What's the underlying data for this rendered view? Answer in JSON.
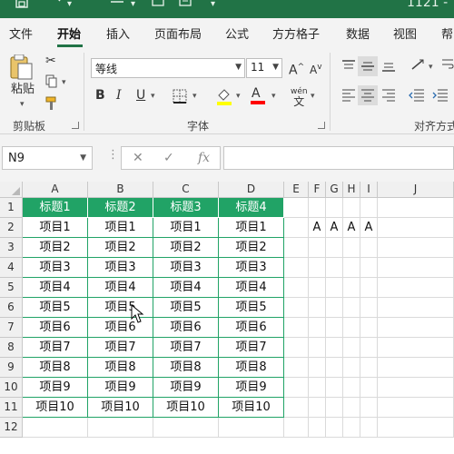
{
  "title_bar": {
    "title_fragment": "1121 -",
    "quick_access": [
      "save-icon",
      "undo-icon",
      "redo-icon"
    ]
  },
  "tabs": [
    "文件",
    "开始",
    "插入",
    "页面布局",
    "公式",
    "方方格子",
    "数据",
    "视图",
    "帮"
  ],
  "active_tab": "开始",
  "ribbon": {
    "clipboard": {
      "paste_label": "粘贴",
      "group_label": "剪贴板"
    },
    "font": {
      "font_name": "等线",
      "font_size": "11",
      "bold": "B",
      "italic": "I",
      "underline": "U",
      "grow_font": "A",
      "shrink_font": "A",
      "font_color_letter": "A",
      "phonetic_top": "wén",
      "phonetic_bottom": "文",
      "group_label": "字体"
    },
    "alignment": {
      "group_label": "对齐方式"
    }
  },
  "formula_bar": {
    "name_box": "N9",
    "formula": "",
    "fx": "fx"
  },
  "sheet": {
    "columns": [
      "A",
      "B",
      "C",
      "D",
      "E",
      "F",
      "G",
      "H",
      "I",
      "J"
    ],
    "rows": [
      "1",
      "2",
      "3",
      "4",
      "5",
      "6",
      "7",
      "8",
      "9",
      "10",
      "11",
      "12"
    ],
    "table_headers": [
      "标题1",
      "标题2",
      "标题3",
      "标题4"
    ],
    "table_rows": [
      [
        "项目1",
        "项目1",
        "项目1",
        "项目1"
      ],
      [
        "项目2",
        "项目2",
        "项目2",
        "项目2"
      ],
      [
        "项目3",
        "项目3",
        "项目3",
        "项目3"
      ],
      [
        "项目4",
        "项目4",
        "项目4",
        "项目4"
      ],
      [
        "项目5",
        "项目5",
        "项目5",
        "项目5"
      ],
      [
        "项目6",
        "项目6",
        "项目6",
        "项目6"
      ],
      [
        "项目7",
        "项目7",
        "项目7",
        "项目7"
      ],
      [
        "项目8",
        "项目8",
        "项目8",
        "项目8"
      ],
      [
        "项目9",
        "项目9",
        "项目9",
        "项目9"
      ],
      [
        "项目10",
        "项目10",
        "项目10",
        "项目10"
      ]
    ],
    "row2_extra": {
      "F": "A",
      "G": "A",
      "H": "A",
      "I": "A"
    }
  },
  "colors": {
    "title_bar": "#217346",
    "table_accent": "#21a366",
    "highlight_yellow": "#ffff00",
    "font_red": "#ff0000",
    "ribbon_bg": "#f3f3f3"
  }
}
